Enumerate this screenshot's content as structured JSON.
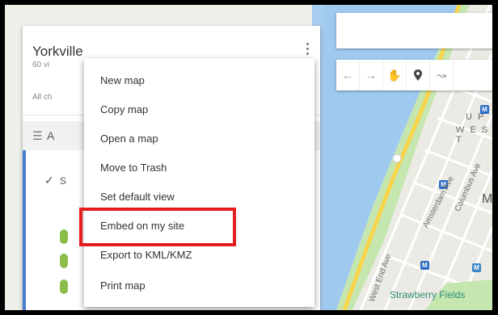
{
  "panel": {
    "title": "Yorkville",
    "views": "60 vi",
    "saved_status": "All ch",
    "layer_letter": "A",
    "layer_check_letter": "S"
  },
  "menu": {
    "items": [
      "New map",
      "Copy map",
      "Open a map",
      "Move to Trash",
      "Set default view",
      "Embed on my site",
      "Export to KML/KMZ",
      "Print map"
    ],
    "highlighted": "Embed on my site"
  },
  "map": {
    "district_line1": "U P",
    "district_line2": "W E S T",
    "district_partial": "M",
    "street1": "Amsterdam Ave",
    "street2": "West End Ave",
    "street3": "Columbus Ave",
    "poi": "Strawberry Fields"
  },
  "toolbar": {
    "icons": [
      "undo-icon",
      "redo-icon",
      "hand-icon",
      "marker-icon",
      "line-icon"
    ]
  },
  "colors": {
    "highlight": "#e41e1e",
    "water": "#9fc9ef",
    "park": "#c6e6b0",
    "road": "#f7d44c",
    "accent": "#4a7fd0"
  }
}
